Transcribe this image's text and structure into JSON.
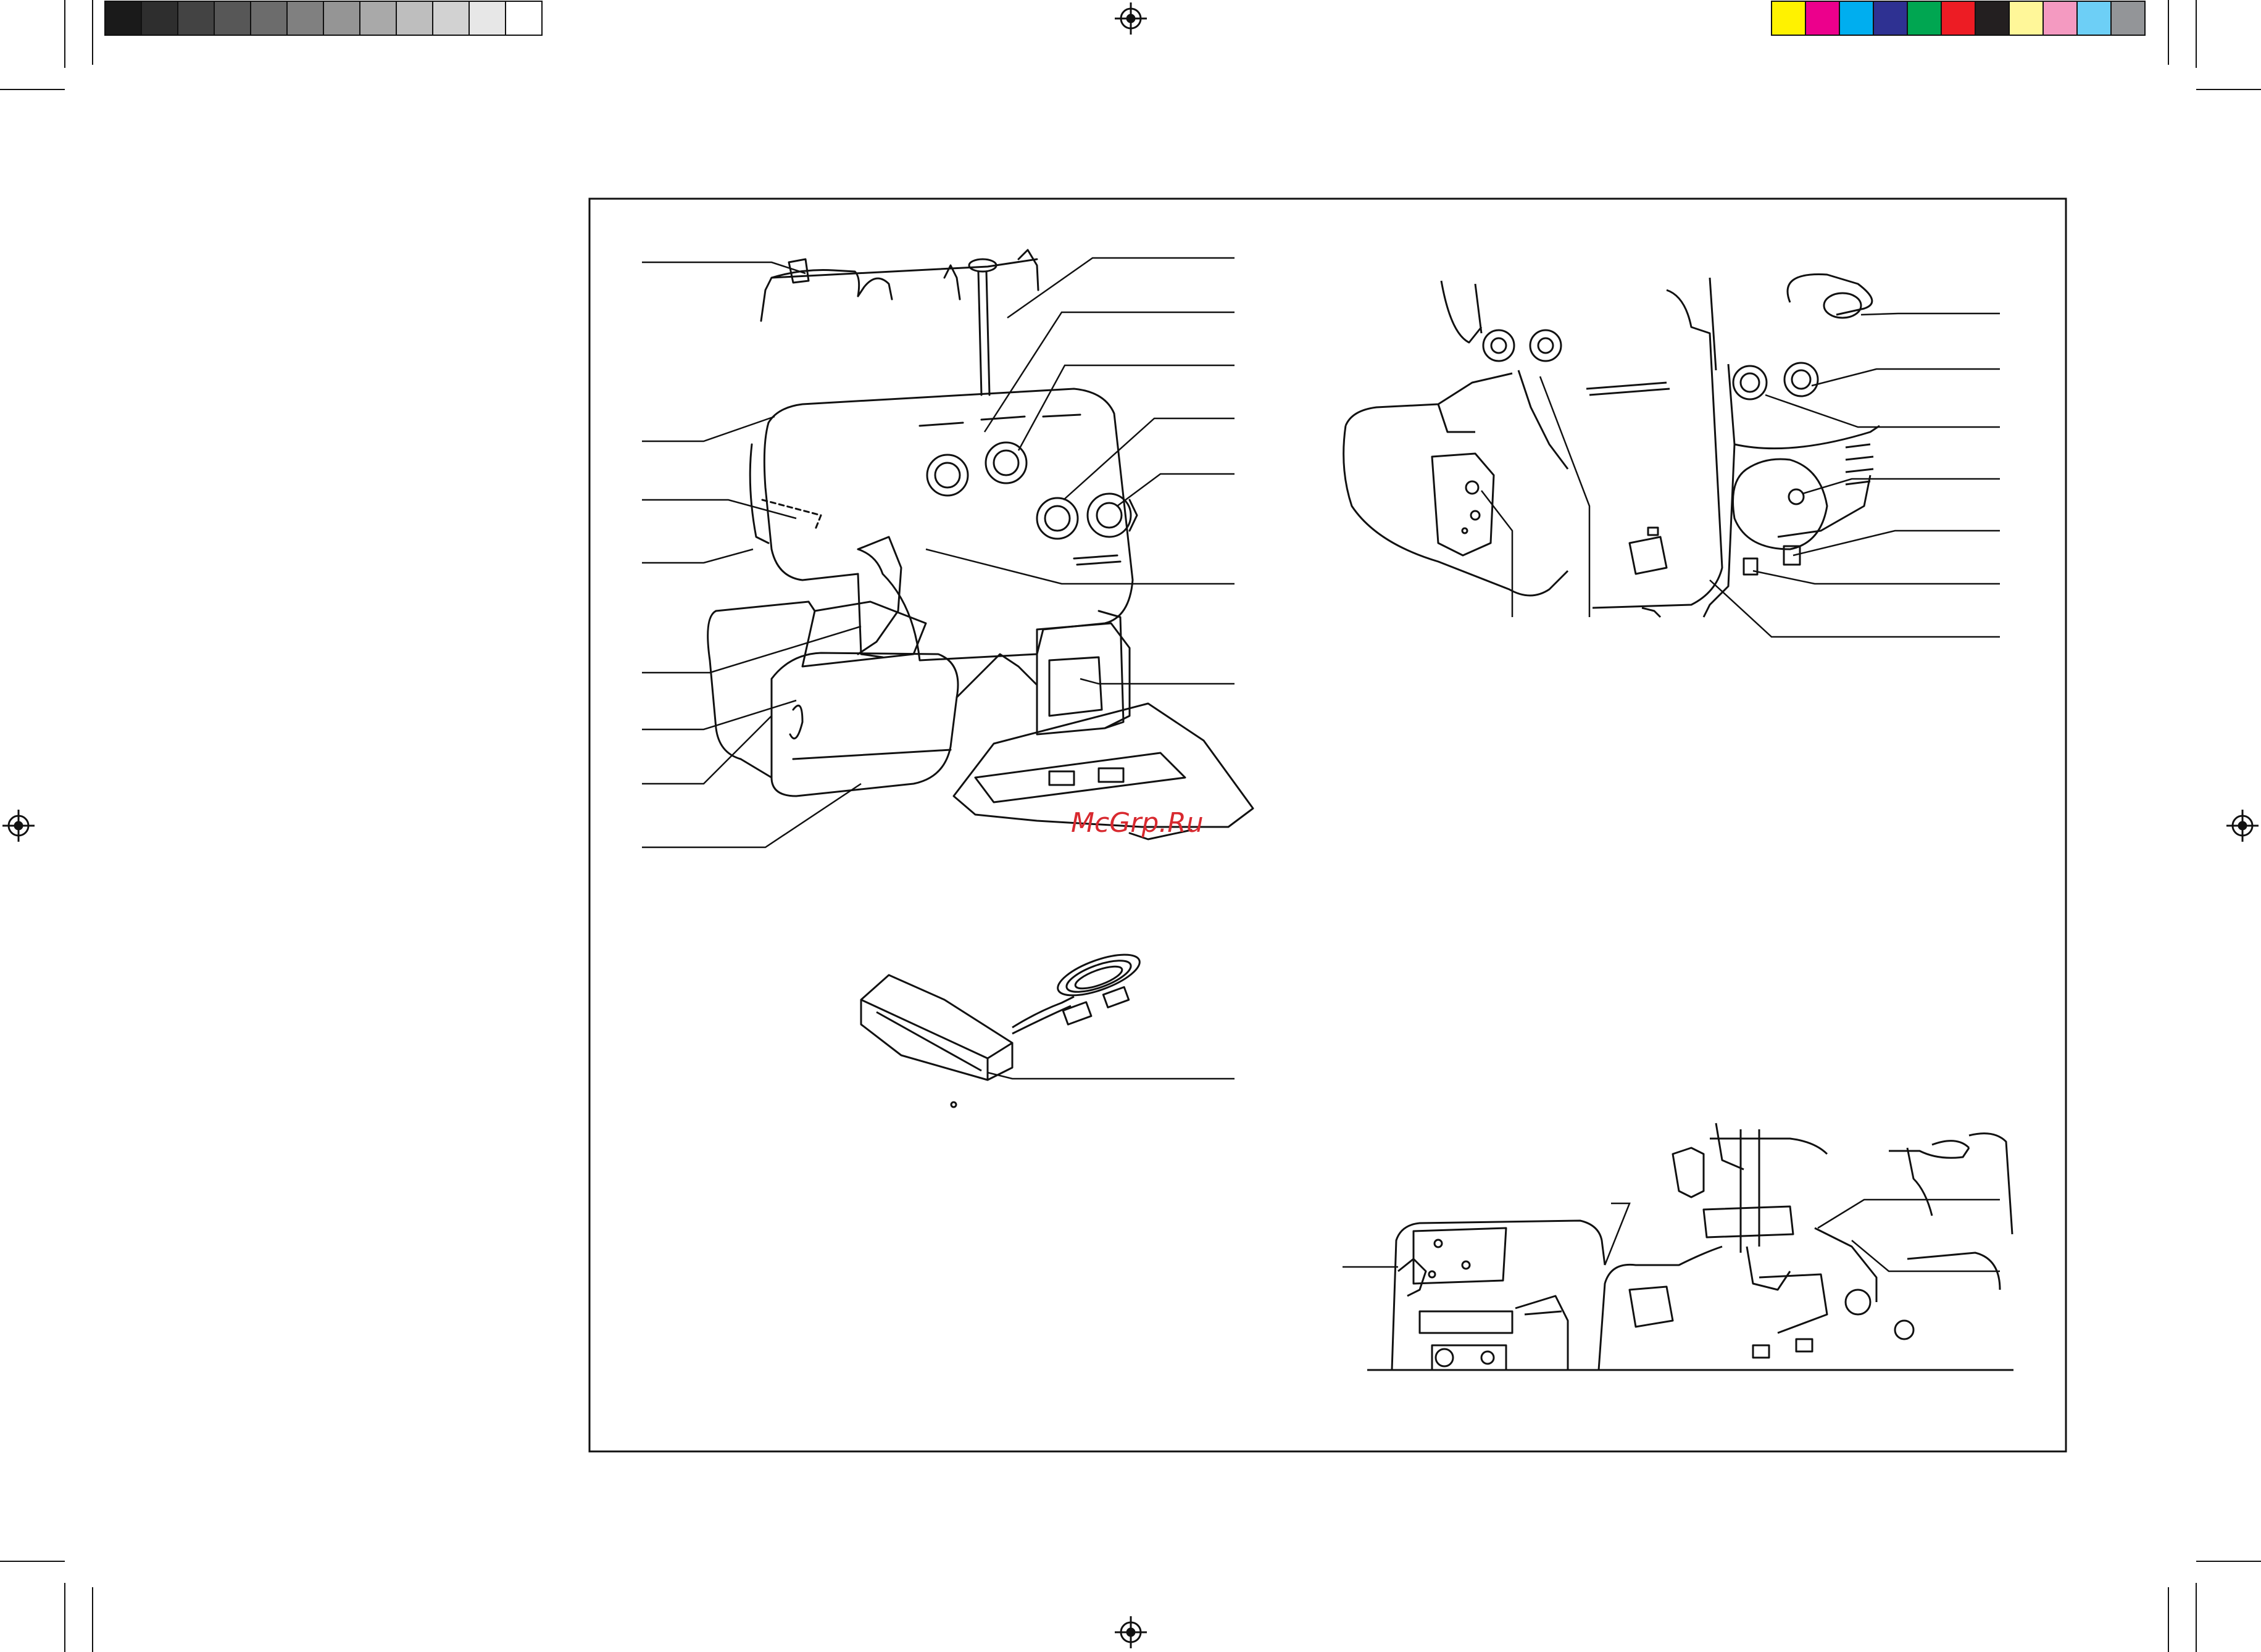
{
  "watermark": "McGrp.Ru",
  "colors": {
    "line": "#111111",
    "watermark": "#d8292f",
    "left_swatches": [
      "#1a1a1a",
      "#2e2e2e",
      "#434343",
      "#575757",
      "#6c6c6c",
      "#808080",
      "#959595",
      "#a9a9a9",
      "#bebebe",
      "#d2d2d2",
      "#e7e7e7",
      "#ffffff"
    ],
    "right_swatches": [
      "#fff200",
      "#ec008c",
      "#00aeef",
      "#2e3192",
      "#00a651",
      "#ed1c24",
      "#231f20",
      "#fff799",
      "#f49ac1",
      "#6dcff6",
      "#939598"
    ]
  },
  "icons": [
    "registration-mark-icon",
    "crop-mark-icon",
    "leader-line-icon"
  ]
}
